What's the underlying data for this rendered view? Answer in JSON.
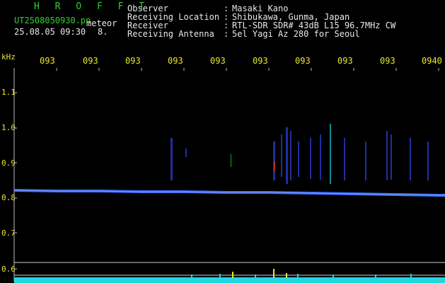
{
  "header": {
    "title": "H R O F F T",
    "filename": "UT2508050930.pn",
    "meteor_label": "meteor",
    "datetime": "25.08.05 09:30",
    "count": "8."
  },
  "info": [
    {
      "label": "Observer",
      "sep": ":",
      "value": "Masaki Kano"
    },
    {
      "label": "Receiving Location",
      "sep": ":",
      "value": "Shibukawa, Gunma, Japan"
    },
    {
      "label": "Receiver",
      "sep": ":",
      "value": "RTL-SDR SDR# 43dB L15 96.7MHz CW"
    },
    {
      "label": "Receiving Antenna",
      "sep": ":",
      "value": "5el Yagi Az 280 for Seoul"
    }
  ],
  "axis": {
    "unit_label": "kHz",
    "y_ticks": [
      "1.1",
      "1.0",
      "0.9",
      "0.8",
      "0.7",
      "0.6"
    ],
    "time_ticks": [
      "093",
      "093",
      "093",
      "093",
      "093",
      "093",
      "093",
      "093",
      "093",
      "0940"
    ]
  },
  "colors": {
    "background": "#000000",
    "text_green": "#2fd02f",
    "text_white": "#e8e8e8",
    "text_yellow": "#e8e830",
    "carrier": "#3a6cff",
    "meteor": "#2b3fd6",
    "noise_floor": "#1fd8e0"
  }
}
